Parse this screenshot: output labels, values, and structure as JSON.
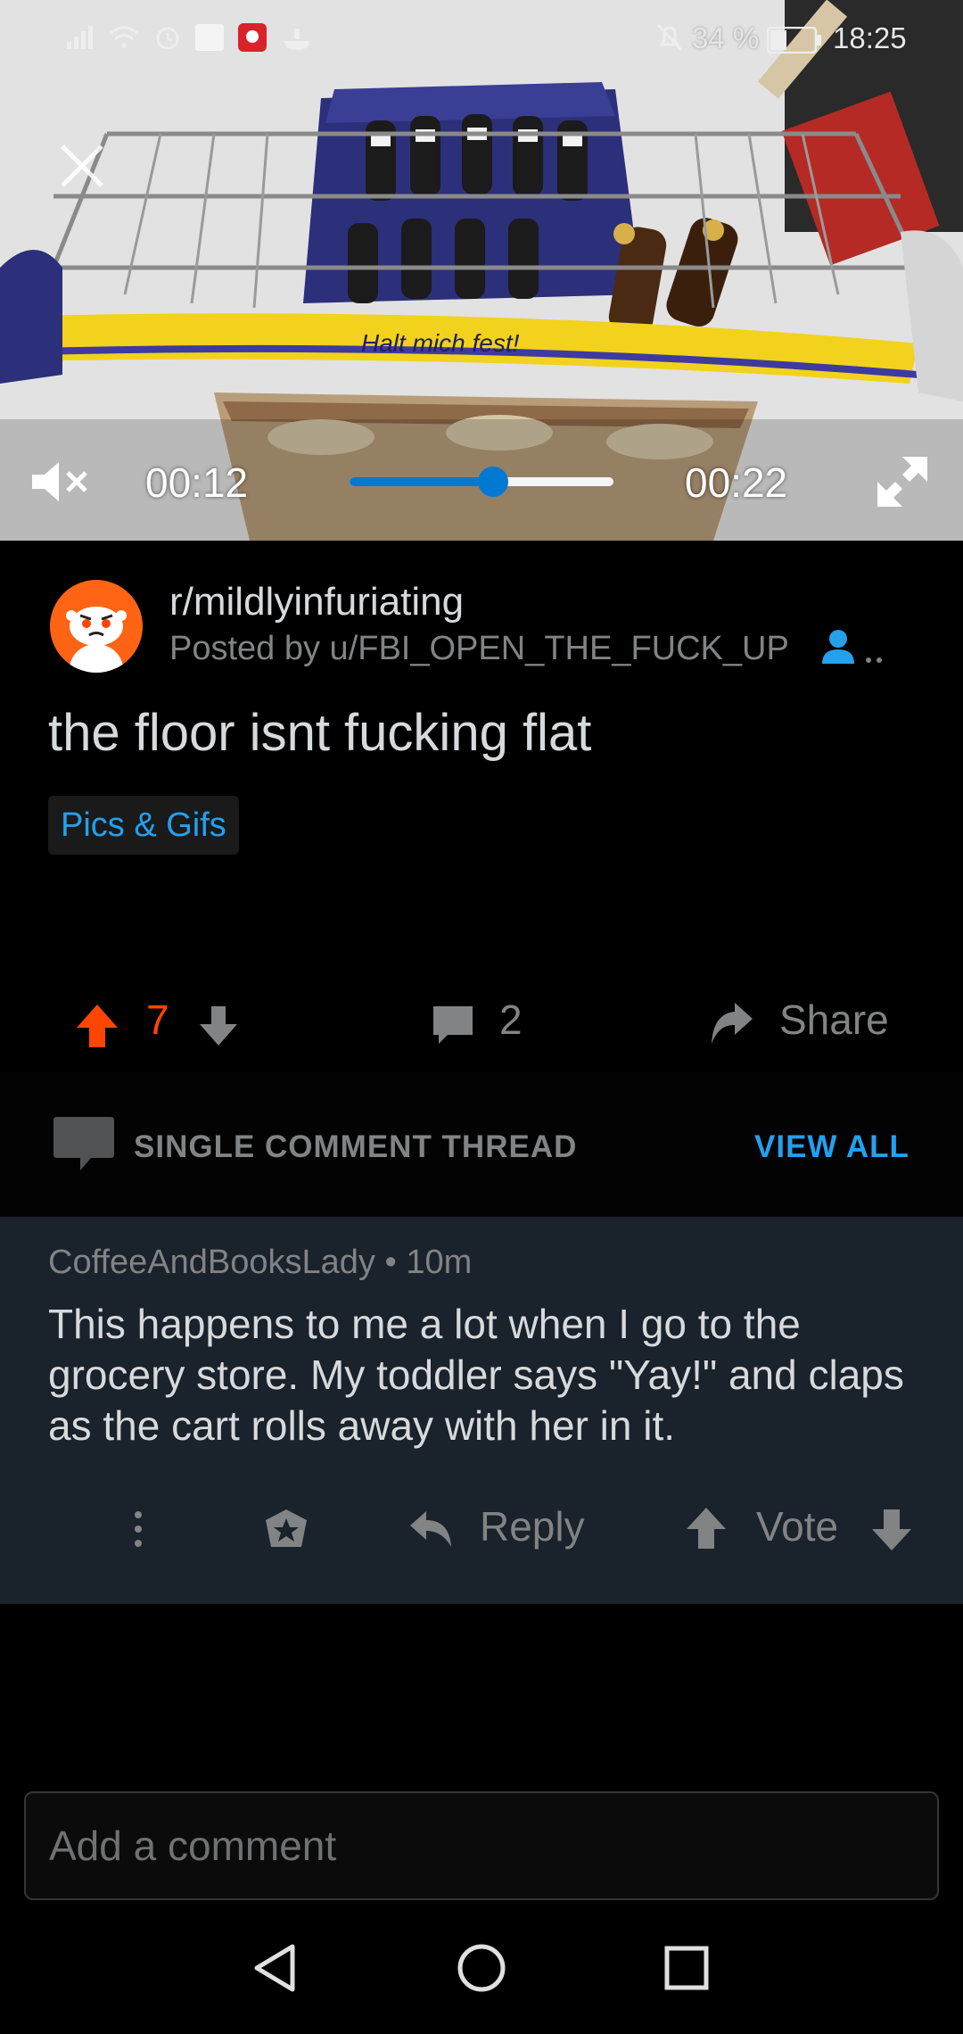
{
  "status_bar": {
    "battery": "34 %",
    "time": "18:25"
  },
  "video": {
    "sign_text": "Halt mich fest!",
    "current_time": "00:12",
    "duration": "00:22",
    "progress": 0.545
  },
  "post": {
    "subreddit": "r/mildlyinfuriating",
    "posted_by": "Posted by u/FBI_OPEN_THE_FUCK_UP",
    "title": "the floor isnt fucking flat",
    "flair": "Pics & Gifs",
    "upvotes": "7",
    "comments": "2",
    "share_label": "Share"
  },
  "thread": {
    "label": "SINGLE COMMENT THREAD",
    "view_all": "VIEW ALL"
  },
  "comment": {
    "author": "CoffeeAndBooksLady",
    "age": "10m",
    "body": "This happens to me a lot when I go to the grocery store. My toddler says \"Yay!\" and claps as the cart rolls away with her in it.",
    "reply_label": "Reply",
    "vote_label": "Vote"
  },
  "composer": {
    "placeholder": "Add a comment"
  },
  "colors": {
    "upvote_orange": "#ff4500",
    "link_blue": "#24a0ed",
    "seek_blue": "#0079d3",
    "comment_bg": "#1a222b"
  }
}
